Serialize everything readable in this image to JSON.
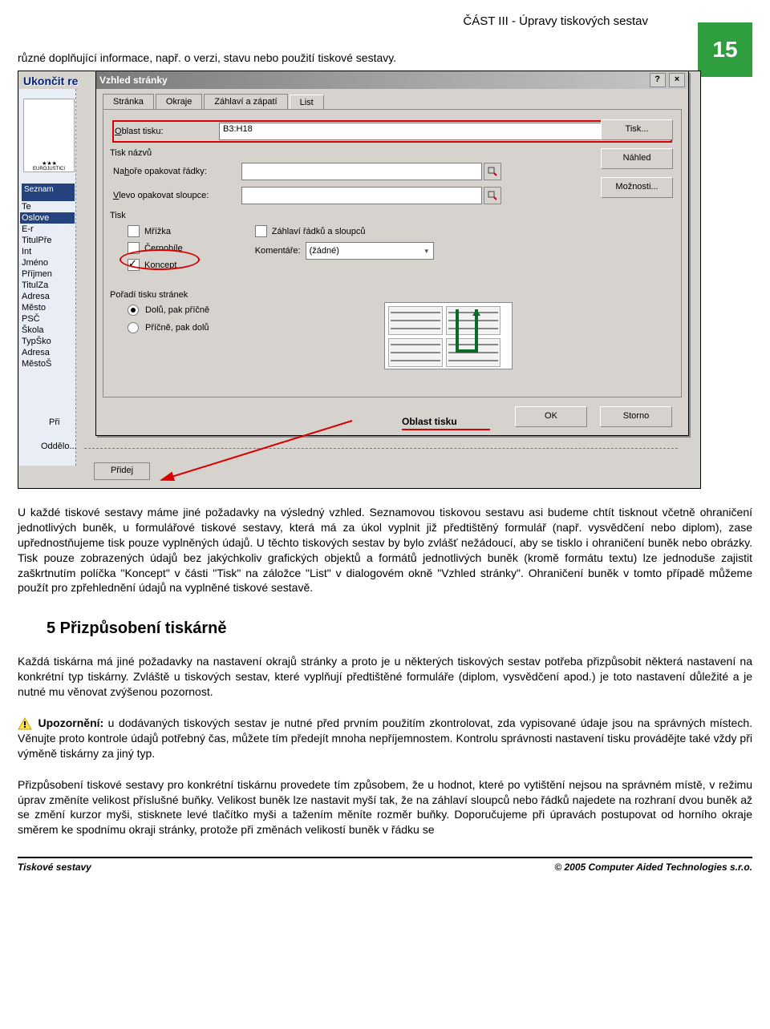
{
  "header": {
    "part_title": "ČÁST III - Úpravy tiskových sestav",
    "page_number": "15"
  },
  "intro_line": "různé doplňující informace, např. o verzi, stavu nebo použití tiskové sestavy.",
  "bg_window": {
    "title": "Ukončit re",
    "badge": "Seznam",
    "logo_text": "EUROJUSTICI",
    "list_items": [
      "Te",
      "Oslove",
      "E-r",
      "TitulPře",
      "Int",
      "Jméno",
      "Příjmen",
      "TitulZa",
      "Adresa",
      "Město",
      "PSČ",
      "Škola",
      "TypŠko",
      "Adresa",
      "MěstoŠ"
    ],
    "selected_index": 1,
    "pri_label": "Při",
    "odd_label": "Oddělo...",
    "pridej_btn": "Přidej"
  },
  "dialog": {
    "title": "Vzhled stránky",
    "help_btn": "?",
    "close_btn": "×",
    "tabs": [
      "Stránka",
      "Okraje",
      "Záhlaví a zápatí",
      "List"
    ],
    "active_tab_index": 3,
    "print_area_label": "Oblast tisku:",
    "print_area_value": "B3:H18",
    "group_names": "Tisk názvů",
    "rows_label_pre": "Na",
    "rows_label_ul": "h",
    "rows_label_post": "oře opakovat řádky:",
    "rows_value": "",
    "cols_label_pre": "",
    "cols_label_ul": "V",
    "cols_label_post": "levo opakovat sloupce:",
    "cols_value": "",
    "group_tisk": "Tisk",
    "chk_grid_pre": "Mří",
    "chk_grid_ul": "ž",
    "chk_grid_post": "ka",
    "chk_bw_pre": "Č",
    "chk_bw_ul": "e",
    "chk_bw_post": "rnobíle",
    "chk_draft_ul": "K",
    "chk_draft_post": "oncept",
    "chk_headers_pre": "",
    "chk_headers_ul": "Z",
    "chk_headers_post": "áhlaví řádků a sloupců",
    "comments_label_pre": "Ko",
    "comments_label_ul": "m",
    "comments_label_post": "entáře:",
    "comments_value": "(žádné)",
    "group_order": "Pořadí tisku stránek",
    "radio_down_pre": "",
    "radio_down_ul": "D",
    "radio_down_post": "olů, pak příčně",
    "radio_across_pre": "Příčně, p",
    "radio_across_ul": "a",
    "radio_across_post": "k dolů",
    "btn_print_ul": "T",
    "btn_print_post": "isk...",
    "btn_preview_ul": "N",
    "btn_preview_post": "áhled",
    "btn_options_pre": "M",
    "btn_options_ul": "o",
    "btn_options_post": "žnosti...",
    "btn_ok": "OK",
    "btn_cancel": "Storno",
    "callout_label": "Oblast tisku"
  },
  "para1": "U každé tiskové sestavy máme jiné požadavky na výsledný vzhled. Seznamovou tiskovou sestavu asi budeme chtít tisknout včetně ohraničení jednotlivých buněk, u formulářové tiskové sestavy, která má za úkol vyplnit již předtištěný formulář (např. vysvědčení nebo diplom), zase upřednostňujeme tisk pouze vyplněných údajů. U těchto tiskových sestav by bylo zvlášť nežádoucí, aby se tisklo i ohraničení buněk nebo obrázky. Tisk pouze zobrazených údajů bez jakýchkoliv grafických objektů a formátů jednotlivých buněk (kromě formátu textu) lze jednoduše zajistit zaškrtnutím políčka \"Koncept\" v části \"Tisk\" na záložce \"List\" v dialogovém okně \"Vzhled stránky\". Ohraničení buněk v tomto případě můžeme použít pro zpřehlednění údajů na vyplněné tiskové sestavě.",
  "section5_heading": "5  Přizpůsobení tiskárně",
  "para2": "Každá tiskárna má jiné požadavky na nastavení okrajů stránky a proto je u některých tiskových sestav potřeba přizpůsobit některá nastavení na konkrétní typ tiskárny. Zvláště u tiskových sestav, které vyplňují předtištěné formuláře (diplom, vysvědčení apod.) je toto nastavení důležité a je nutné mu věnovat zvýšenou pozornost.",
  "warning_label": "Upozornění:",
  "para3": " u dodávaných tiskových sestav je nutné před prvním použitím zkontrolovat, zda vypisované údaje jsou na správných místech. Věnujte proto kontrole údajů potřebný čas, můžete tím předejít mnoha nepříjemnostem. Kontrolu správnosti nastavení tisku provádějte také vždy při výměně tiskárny za jiný typ.",
  "para4": "Přizpůsobení tiskové sestavy pro konkrétní tiskárnu provedete tím způsobem, že u hodnot, které po vytištění nejsou na správném místě, v režimu úprav změníte velikost příslušné buňky. Velikost buněk lze nastavit myší tak, že na záhlaví sloupců nebo řádků najedete na rozhraní dvou buněk až se změní kurzor myši, stisknete levé tlačítko myši a tažením měníte rozměr buňky. Doporučujeme při úpravách postupovat od horního okraje směrem ke spodnímu okraji stránky, protože při změnách velikostí buněk v řádku se",
  "footer_left": "Tiskové sestavy",
  "footer_right": "© 2005 Computer Aided Technologies s.r.o."
}
